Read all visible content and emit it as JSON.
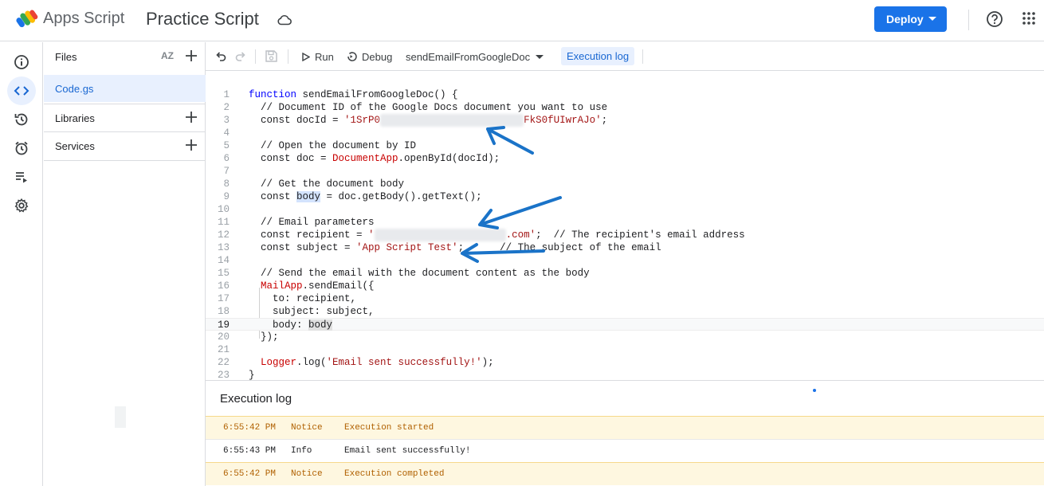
{
  "app": {
    "name": "Apps Script",
    "project_title": "Practice Script"
  },
  "header": {
    "deploy_label": "Deploy"
  },
  "files_panel": {
    "files_label": "Files",
    "sort_label": "AZ",
    "files": [
      {
        "name": "Code.gs"
      }
    ],
    "libraries_label": "Libraries",
    "services_label": "Services"
  },
  "toolbar": {
    "run_label": "Run",
    "debug_label": "Debug",
    "function_select": "sendEmailFromGoogleDoc",
    "execution_log_label": "Execution log"
  },
  "editor": {
    "current_line": 19,
    "lines": [
      {
        "n": "1"
      },
      {
        "n": "2"
      },
      {
        "n": "3"
      },
      {
        "n": "4"
      },
      {
        "n": "5"
      },
      {
        "n": "6"
      },
      {
        "n": "7"
      },
      {
        "n": "8"
      },
      {
        "n": "9"
      },
      {
        "n": "10"
      },
      {
        "n": "11"
      },
      {
        "n": "12"
      },
      {
        "n": "13"
      },
      {
        "n": "14"
      },
      {
        "n": "15"
      },
      {
        "n": "16"
      },
      {
        "n": "17"
      },
      {
        "n": "18"
      },
      {
        "n": "19"
      },
      {
        "n": "20"
      },
      {
        "n": "21"
      },
      {
        "n": "22"
      },
      {
        "n": "23"
      }
    ],
    "tokens": {
      "l1_kw": "function",
      "l1_rest": " sendEmailFromGoogleDoc() {",
      "l2": "  // Document ID of the Google Docs document you want to use",
      "l3_a": "  const docId = ",
      "l3_b": "'1SrP0",
      "l3_c": "FkS0fUIwrAJo'",
      "l3_d": ";",
      "l5": "  // Open the document by ID",
      "l6_a": "  const doc = ",
      "l6_b": "DocumentApp",
      "l6_c": ".openById(docId);",
      "l8": "  // Get the document body",
      "l9_a": "  const ",
      "l9_b": "body",
      "l9_c": " = doc.getBody().getText();",
      "l11": "  // Email parameters",
      "l12_a": "  const recipient = ",
      "l12_b": "'",
      "l12_c": ".com'",
      "l12_d": ";  // The recipient's email address",
      "l13_a": "  const subject = ",
      "l13_b": "'App Script Test'",
      "l13_c": ";      // The subject of the email",
      "l15": "  // Send the email with the document content as the body",
      "l16_a": "  ",
      "l16_b": "MailApp",
      "l16_c": ".sendEmail({",
      "l17": "    to: recipient,",
      "l18": "    subject: subject,",
      "l19_a": "    body: ",
      "l19_b": "body",
      "l20": "  });",
      "l22_a": "  ",
      "l22_b": "Logger",
      "l22_c": ".log(",
      "l22_d": "'Email sent successfully!'",
      "l22_e": ");",
      "l23": "}"
    }
  },
  "execution_log": {
    "title": "Execution log",
    "rows": [
      {
        "time": "6:55:42 PM",
        "level": "Notice",
        "message": "Execution started"
      },
      {
        "time": "6:55:43 PM",
        "level": "Info",
        "message": "Email sent successfully!"
      },
      {
        "time": "6:55:42 PM",
        "level": "Notice",
        "message": "Execution completed"
      }
    ]
  },
  "colors": {
    "accent": "#1a73e8",
    "arrow": "#1a73c8",
    "notice_bg": "#fef7e0"
  },
  "icons": [
    "apps-script-logo",
    "cloud-icon",
    "help-icon",
    "apps-grid-icon",
    "info-icon",
    "code-icon",
    "history-icon",
    "alarm-icon",
    "executions-icon",
    "settings-icon",
    "undo-icon",
    "redo-icon",
    "save-icon",
    "play-icon",
    "debug-icon",
    "dropdown-icon",
    "plus-icon"
  ]
}
